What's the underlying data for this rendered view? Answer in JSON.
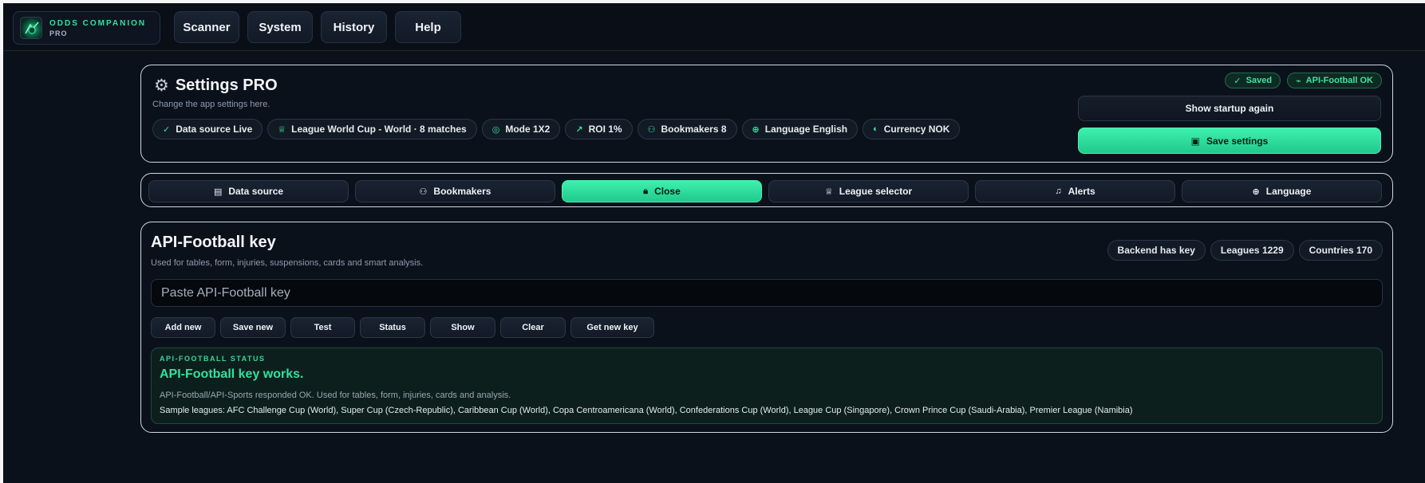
{
  "app": {
    "brand_name": "ODDS COMPANION",
    "brand_sub": "PRO",
    "nav": [
      "Scanner",
      "System",
      "History",
      "Help"
    ]
  },
  "settings": {
    "title": "Settings PRO",
    "subtitle": "Change the app settings here.",
    "chips": [
      {
        "icon": "check-icon",
        "label": "Data source Live"
      },
      {
        "icon": "trophy-icon",
        "label": "League World Cup - World · 8 matches"
      },
      {
        "icon": "target-icon",
        "label": "Mode 1X2"
      },
      {
        "icon": "chart-icon",
        "label": "ROI 1%"
      },
      {
        "icon": "users-icon",
        "label": "Bookmakers 8"
      },
      {
        "icon": "globe-icon",
        "label": "Language English"
      },
      {
        "icon": "coin-icon",
        "label": "Currency NOK"
      }
    ],
    "badges": {
      "saved": "Saved",
      "api": "API-Football OK"
    },
    "show_startup": "Show startup again",
    "save": "Save settings"
  },
  "tabs": [
    {
      "icon": "database-icon",
      "label": "Data source",
      "active": false
    },
    {
      "icon": "users-icon",
      "label": "Bookmakers",
      "active": false
    },
    {
      "icon": "lock-icon",
      "label": "Close",
      "active": true
    },
    {
      "icon": "trophy-icon",
      "label": "League selector",
      "active": false
    },
    {
      "icon": "bell-icon",
      "label": "Alerts",
      "active": false
    },
    {
      "icon": "globe-icon",
      "label": "Language",
      "active": false
    }
  ],
  "api": {
    "title": "API-Football key",
    "subtitle": "Used for tables, form, injuries, suspensions, cards and smart analysis.",
    "badges": [
      "Backend has key",
      "Leagues 1229",
      "Countries 170"
    ],
    "input_placeholder": "Paste API-Football key",
    "input_value": "",
    "actions": [
      "Add new",
      "Save new",
      "Test",
      "Status",
      "Show",
      "Clear",
      "Get new key"
    ],
    "status": {
      "label": "API-FOOTBALL STATUS",
      "headline": "API-Football key works.",
      "description": "API-Football/API-Sports responded OK. Used for tables, form, injuries, cards and analysis.",
      "samples": "Sample leagues: AFC Challenge Cup (World), Super Cup (Czech-Republic), Caribbean Cup (World), Copa Centroamericana (World), Confederations Cup (World), League Cup (Singapore), Crown Prince Cup (Saudi-Arabia), Premier League (Namibia)"
    }
  },
  "colors": {
    "accent": "#2fe3a0",
    "background": "#0b111b",
    "panel_border": "#cfd6de"
  }
}
